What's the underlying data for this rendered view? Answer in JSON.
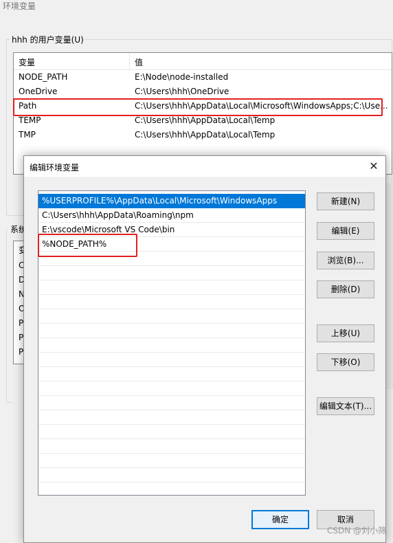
{
  "background_window": {
    "title": "环境变量",
    "user_group_label": "hhh 的用户变量(U)",
    "columns": [
      "变量",
      "值"
    ],
    "rows": [
      {
        "name": "NODE_PATH",
        "value": "E:\\Node\\node-installed"
      },
      {
        "name": "OneDrive",
        "value": "C:\\Users\\hhh\\OneDrive"
      },
      {
        "name": "Path",
        "value": "C:\\Users\\hhh\\AppData\\Local\\Microsoft\\WindowsApps;C:\\Use..."
      },
      {
        "name": "TEMP",
        "value": "C:\\Users\\hhh\\AppData\\Local\\Temp"
      },
      {
        "name": "TMP",
        "value": "C:\\Users\\hhh\\AppData\\Local\\Temp"
      }
    ],
    "system_group_label_partial": "系统",
    "system_rows_partial": [
      "变",
      "C",
      "D",
      "N",
      "O",
      "P",
      "P",
      "P"
    ]
  },
  "dialog": {
    "title": "编辑环境变量",
    "close_label": "✕",
    "entries": [
      "%USERPROFILE%\\AppData\\Local\\Microsoft\\WindowsApps",
      "C:\\Users\\hhh\\AppData\\Roaming\\npm",
      "E:\\vscode\\Microsoft VS Code\\bin",
      "%NODE_PATH%"
    ],
    "buttons": {
      "new": "新建(N)",
      "edit": "编辑(E)",
      "browse": "浏览(B)...",
      "delete": "删除(D)",
      "move_up": "上移(U)",
      "move_down": "下移(O)",
      "edit_text": "编辑文本(T)...",
      "ok": "确定",
      "cancel": "取消"
    }
  },
  "watermark": "CSDN @刘小筛",
  "colors": {
    "selection": "#0078d7",
    "highlight_box": "#e02020"
  }
}
